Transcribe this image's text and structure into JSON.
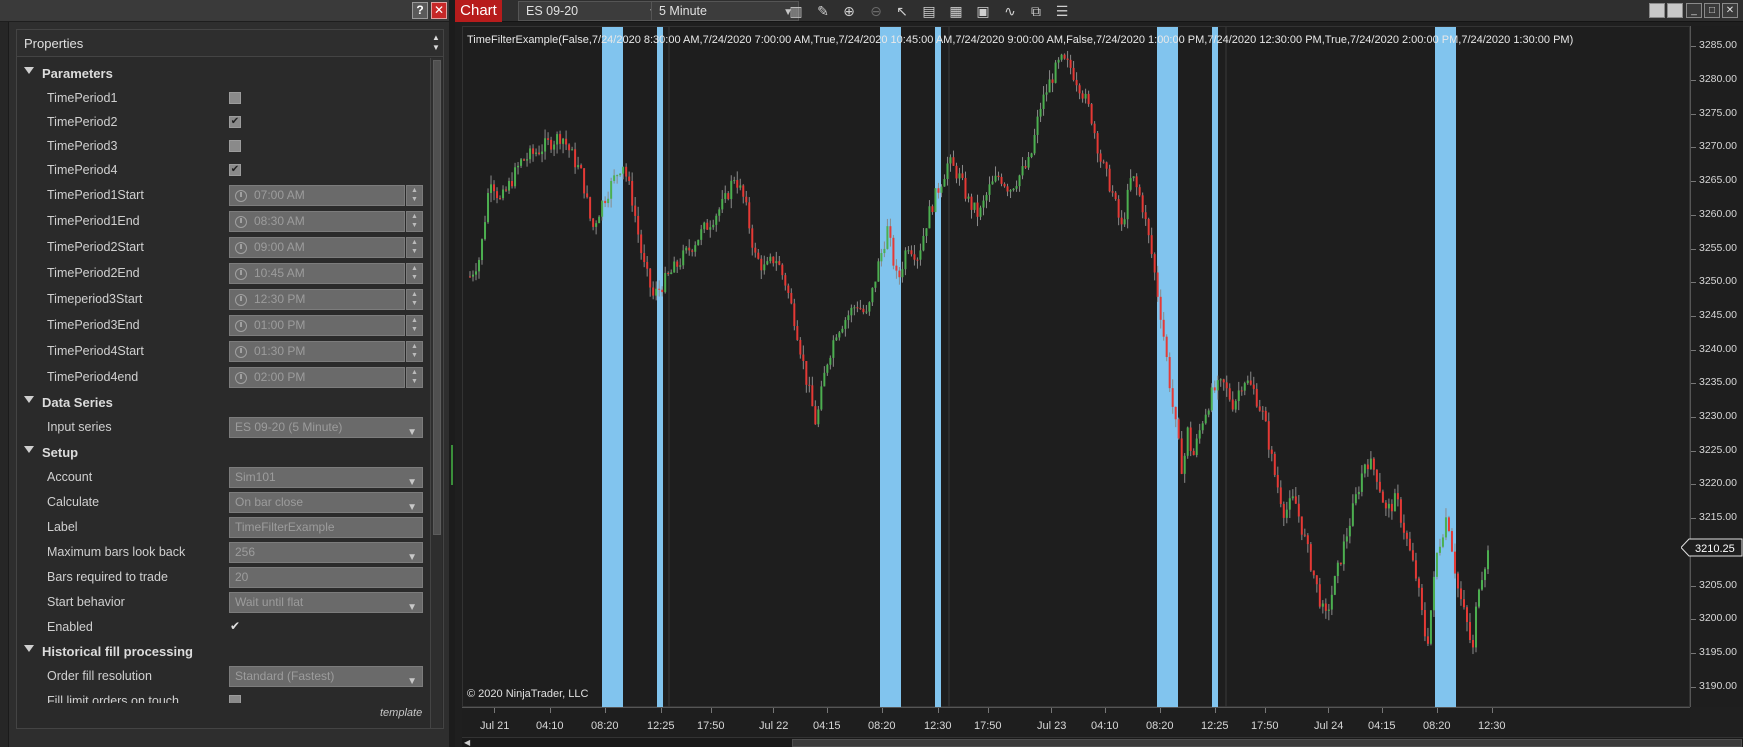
{
  "left_panel": {
    "help_label": "?",
    "close_label": "✕",
    "header": "Properties",
    "categories": {
      "parameters": "Parameters",
      "data_series": "Data Series",
      "setup": "Setup",
      "historical": "Historical fill processing"
    },
    "parameters": {
      "tp1": {
        "label": "TimePeriod1",
        "checked": false
      },
      "tp2": {
        "label": "TimePeriod2",
        "checked": true
      },
      "tp3": {
        "label": "TimePeriod3",
        "checked": false
      },
      "tp4": {
        "label": "TimePeriod4",
        "checked": true
      },
      "tp1_start": {
        "label": "TimePeriod1Start",
        "value": "07:00 AM"
      },
      "tp1_end": {
        "label": "TimePeriod1End",
        "value": "08:30 AM"
      },
      "tp2_start": {
        "label": "TimePeriod2Start",
        "value": "09:00 AM"
      },
      "tp2_end": {
        "label": "TimePeriod2End",
        "value": "10:45 AM"
      },
      "tp3_start": {
        "label": "Timeperiod3Start",
        "value": "12:30 PM"
      },
      "tp3_end": {
        "label": "TimePeriod3End",
        "value": "01:00 PM"
      },
      "tp4_start": {
        "label": "TimePeriod4Start",
        "value": "01:30 PM"
      },
      "tp4_end": {
        "label": "TimePeriod4end",
        "value": "02:00 PM"
      }
    },
    "data_series": {
      "input_series": {
        "label": "Input series",
        "value": "ES 09-20 (5 Minute)"
      }
    },
    "setup": {
      "account": {
        "label": "Account",
        "value": "Sim101"
      },
      "calculate": {
        "label": "Calculate",
        "value": "On bar close"
      },
      "label": {
        "label": "Label",
        "value": "TimeFilterExample"
      },
      "max_bars": {
        "label": "Maximum bars look back",
        "value": "256"
      },
      "bars_required": {
        "label": "Bars required to trade",
        "value": "20"
      },
      "start_behavior": {
        "label": "Start behavior",
        "value": "Wait until flat"
      },
      "enabled": {
        "label": "Enabled",
        "checked": true
      }
    },
    "historical": {
      "order_fill": {
        "label": "Order fill resolution",
        "value": "Standard (Fastest)"
      },
      "fill_limit": {
        "label": "Fill limit orders on touch"
      }
    },
    "template_label": "template"
  },
  "chart_window": {
    "tab_label": "Chart",
    "instrument": "ES 09-20",
    "interval": "5 Minute",
    "toolbar_icons": [
      "bar-type-icon",
      "draw-pencil-icon",
      "zoom-in-icon",
      "zoom-out-icon",
      "pointer-icon",
      "data-box-icon",
      "properties-icon",
      "chart-trader-icon",
      "indicators-icon",
      "strategies-icon",
      "templates-icon"
    ],
    "indicator_label": "TimeFilterExample(False,7/24/2020 8:30:00 AM,7/24/2020 7:00:00 AM,True,7/24/2020 10:45:00 AM,7/24/2020 9:00:00 AM,False,7/24/2020 1:00:00 PM,7/24/2020 12:30:00 PM,True,7/24/2020 2:00:00 PM,7/24/2020 1:30:00 PM)",
    "copyright": "© 2020 NinjaTrader, LLC",
    "last_price": "3210.25"
  },
  "chart_data": {
    "type": "candlestick",
    "instrument": "ES 09-20",
    "interval": "5 Minute",
    "y_ticks": [
      "3285.00",
      "3280.00",
      "3275.00",
      "3270.00",
      "3265.00",
      "3260.00",
      "3255.00",
      "3250.00",
      "3245.00",
      "3240.00",
      "3235.00",
      "3230.00",
      "3225.00",
      "3220.00",
      "3215.00",
      "3210.00",
      "3205.00",
      "3200.00",
      "3195.00",
      "3190.00"
    ],
    "ylim": [
      3187,
      3288
    ],
    "x_ticks": [
      "Jul 21",
      "04:10",
      "08:20",
      "12:25",
      "17:50",
      "Jul 22",
      "04:15",
      "08:20",
      "12:30",
      "17:50",
      "Jul 23",
      "04:10",
      "08:20",
      "12:25",
      "17:50",
      "Jul 24",
      "04:15",
      "08:20",
      "12:30"
    ],
    "colors": {
      "up": "#4caf50",
      "down": "#e53935",
      "highlight": "#87cefa",
      "background": "#1e1e1e"
    },
    "highlight_windows": [
      "07:00-08:30",
      "09:00-10:45",
      "12:30-01:00 PM",
      "01:30-02:00 PM"
    ],
    "close_path": [
      [
        0.0,
        3251
      ],
      [
        0.01,
        3254
      ],
      [
        0.02,
        3266
      ],
      [
        0.03,
        3262
      ],
      [
        0.05,
        3268
      ],
      [
        0.07,
        3270
      ],
      [
        0.09,
        3272
      ],
      [
        0.11,
        3266
      ],
      [
        0.12,
        3258
      ],
      [
        0.13,
        3262
      ],
      [
        0.15,
        3268
      ],
      [
        0.16,
        3262
      ],
      [
        0.17,
        3253
      ],
      [
        0.18,
        3248
      ],
      [
        0.2,
        3252
      ],
      [
        0.22,
        3256
      ],
      [
        0.24,
        3260
      ],
      [
        0.25,
        3262
      ],
      [
        0.26,
        3266
      ],
      [
        0.27,
        3262
      ],
      [
        0.28,
        3254
      ],
      [
        0.29,
        3252
      ],
      [
        0.3,
        3254
      ],
      [
        0.31,
        3250
      ],
      [
        0.32,
        3244
      ],
      [
        0.33,
        3236
      ],
      [
        0.34,
        3229
      ],
      [
        0.35,
        3238
      ],
      [
        0.36,
        3243
      ],
      [
        0.38,
        3247
      ],
      [
        0.39,
        3245
      ],
      [
        0.4,
        3252
      ],
      [
        0.41,
        3258
      ],
      [
        0.42,
        3250
      ],
      [
        0.43,
        3256
      ],
      [
        0.44,
        3254
      ],
      [
        0.45,
        3260
      ],
      [
        0.46,
        3264
      ],
      [
        0.47,
        3268
      ],
      [
        0.48,
        3266
      ],
      [
        0.49,
        3262
      ],
      [
        0.5,
        3260
      ],
      [
        0.51,
        3264
      ],
      [
        0.52,
        3266
      ],
      [
        0.53,
        3264
      ],
      [
        0.54,
        3266
      ],
      [
        0.55,
        3268
      ],
      [
        0.56,
        3276
      ],
      [
        0.57,
        3280
      ],
      [
        0.58,
        3283
      ],
      [
        0.59,
        3282
      ],
      [
        0.6,
        3279
      ],
      [
        0.61,
        3275
      ],
      [
        0.62,
        3268
      ],
      [
        0.63,
        3264
      ],
      [
        0.64,
        3258
      ],
      [
        0.65,
        3266
      ],
      [
        0.66,
        3262
      ],
      [
        0.67,
        3254
      ],
      [
        0.68,
        3244
      ],
      [
        0.69,
        3232
      ],
      [
        0.7,
        3222
      ],
      [
        0.705,
        3228
      ],
      [
        0.71,
        3224
      ],
      [
        0.72,
        3230
      ],
      [
        0.73,
        3234
      ],
      [
        0.74,
        3235
      ],
      [
        0.75,
        3232
      ],
      [
        0.76,
        3236
      ],
      [
        0.77,
        3234
      ],
      [
        0.78,
        3230
      ],
      [
        0.79,
        3222
      ],
      [
        0.8,
        3216
      ],
      [
        0.81,
        3218
      ],
      [
        0.82,
        3212
      ],
      [
        0.83,
        3206
      ],
      [
        0.84,
        3200
      ],
      [
        0.85,
        3206
      ],
      [
        0.86,
        3212
      ],
      [
        0.87,
        3218
      ],
      [
        0.88,
        3224
      ],
      [
        0.89,
        3222
      ],
      [
        0.9,
        3216
      ],
      [
        0.91,
        3218
      ],
      [
        0.92,
        3212
      ],
      [
        0.93,
        3206
      ],
      [
        0.94,
        3196
      ],
      [
        0.95,
        3210
      ],
      [
        0.96,
        3216
      ],
      [
        0.97,
        3205
      ],
      [
        0.98,
        3199
      ],
      [
        0.985,
        3195
      ],
      [
        0.99,
        3205
      ],
      [
        1.0,
        3210
      ]
    ]
  }
}
